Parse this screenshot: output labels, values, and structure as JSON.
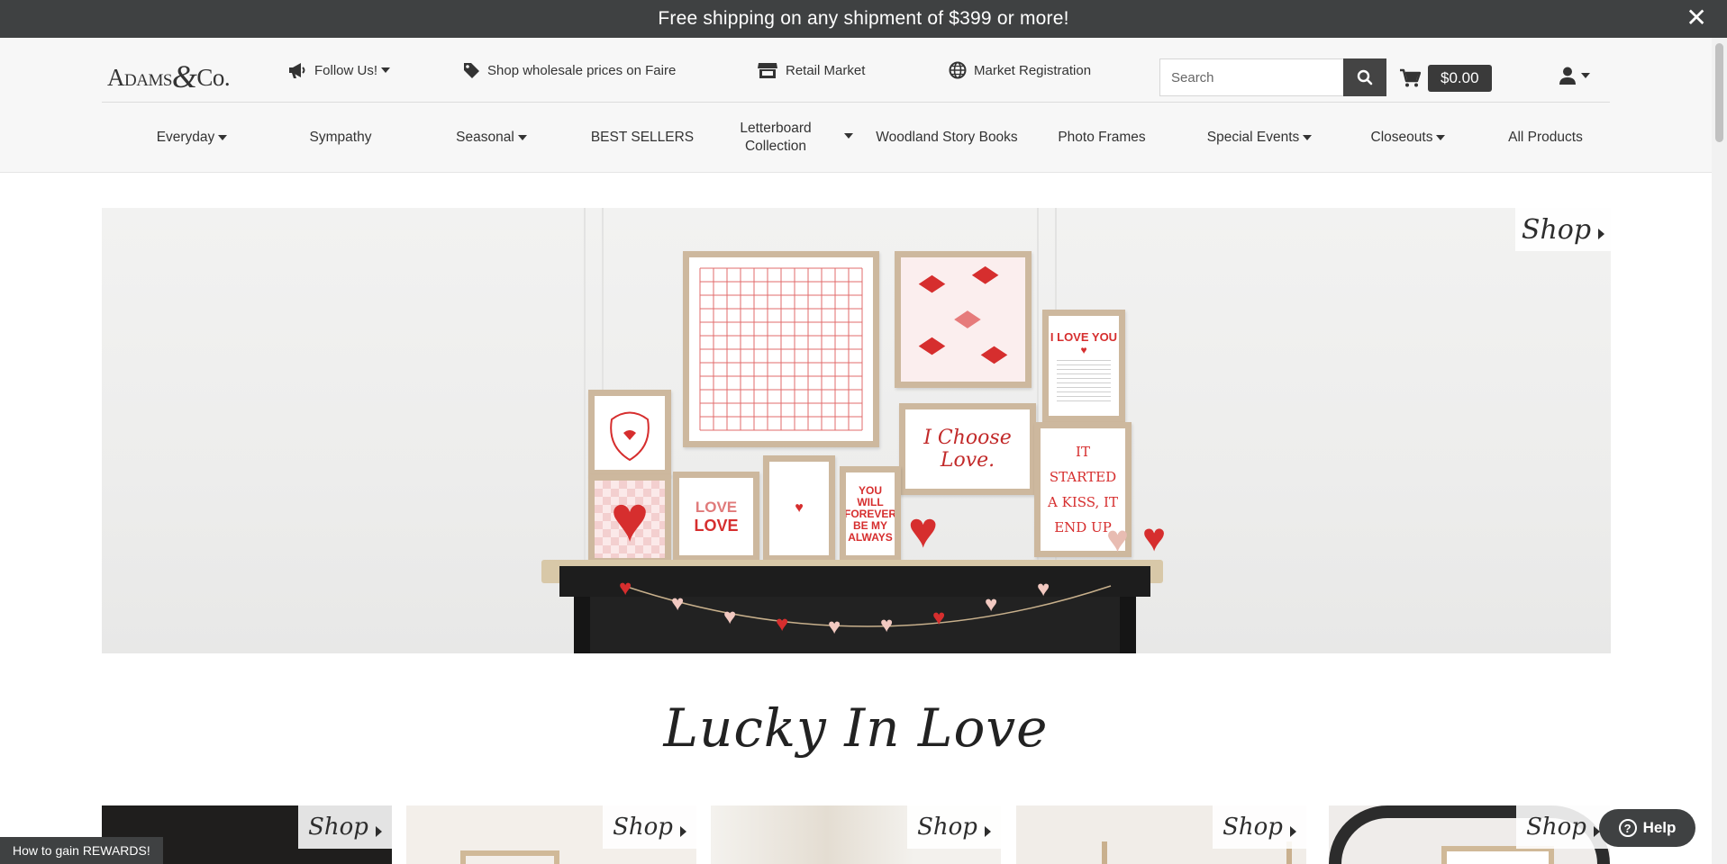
{
  "announcement": {
    "text": "Free shipping on any shipment of $399 or more!",
    "close": "✕"
  },
  "header": {
    "logo": {
      "left": "Adams",
      "amp": "&",
      "right": "Co."
    },
    "follow_us": "Follow Us!",
    "faire": "Shop wholesale prices on Faire",
    "retail_market": "Retail Market",
    "market_registration": "Market Registration",
    "search_placeholder": "Search",
    "cart_total": "$0.00"
  },
  "nav": {
    "items": [
      {
        "label": "Everyday",
        "dropdown": true
      },
      {
        "label": "Sympathy",
        "dropdown": false
      },
      {
        "label": "Seasonal",
        "dropdown": true
      },
      {
        "label": "BEST SELLERS",
        "dropdown": false
      },
      {
        "label": "Letterboard Collection",
        "dropdown": true
      },
      {
        "label": "Woodland Story Books",
        "dropdown": false
      },
      {
        "label": "Photo Frames",
        "dropdown": false
      },
      {
        "label": "Special Events",
        "dropdown": true
      },
      {
        "label": "Closeouts",
        "dropdown": true
      },
      {
        "label": "All Products",
        "dropdown": false
      }
    ]
  },
  "hero": {
    "shop_label": "Shop",
    "signs": {
      "love": "LOVE",
      "love2": "LOVE",
      "forever": "YOU WILL FOREVER BE MY ALWAYS",
      "choose": "I Choose Love.",
      "kiss": "IT STARTED A KISS, IT END UP",
      "iloveyou": "I LOVE YOU"
    }
  },
  "section": {
    "title": "Lucky In Love"
  },
  "tiles": [
    {
      "shop_label": "Shop",
      "bg": "#1f1e1d"
    },
    {
      "shop_label": "Shop",
      "bg": "#f3efea"
    },
    {
      "shop_label": "Shop",
      "bg": "#e9e4dc"
    },
    {
      "shop_label": "Shop",
      "bg": "#f1ede8"
    },
    {
      "shop_label": "Shop",
      "bg": "#efecea"
    }
  ],
  "rewards": "How to gain REWARDS!",
  "help": "Help",
  "colors": {
    "dark_bar": "#3f4142",
    "accent_red": "#d62e2e",
    "header_bg": "#f7f7f7"
  }
}
